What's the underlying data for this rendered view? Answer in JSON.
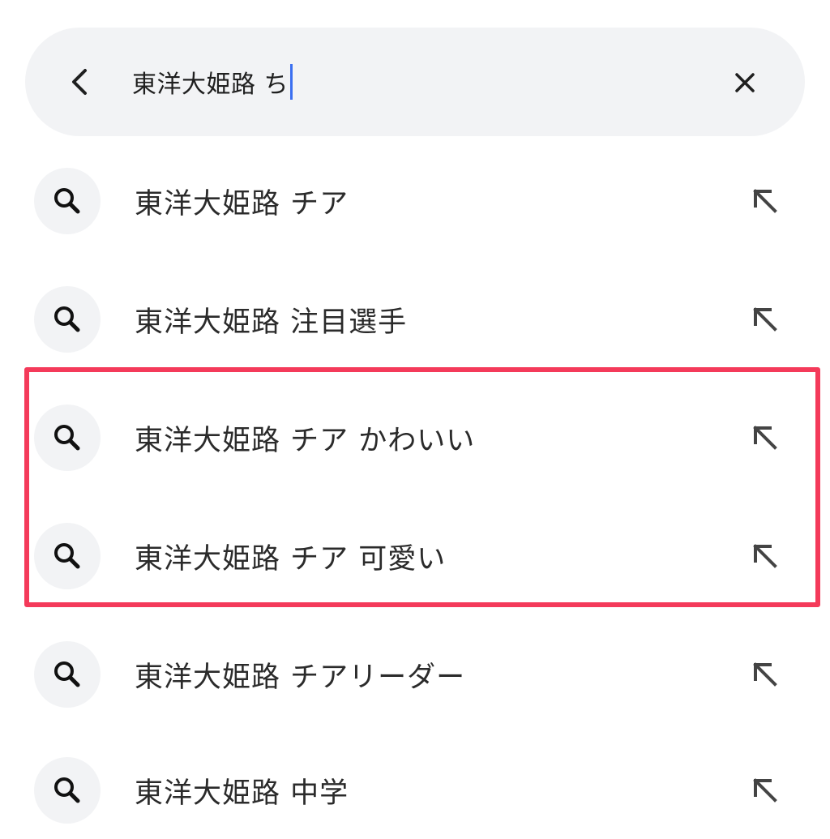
{
  "search": {
    "query": "東洋大姫路 ち",
    "back_icon": "chevron-left-icon",
    "clear_icon": "close-icon"
  },
  "suggestions": [
    {
      "label": "東洋大姫路 チア",
      "icon": "search-icon",
      "fill_icon": "arrow-up-left-icon"
    },
    {
      "label": "東洋大姫路 注目選手",
      "icon": "search-icon",
      "fill_icon": "arrow-up-left-icon"
    },
    {
      "label": "東洋大姫路 チア かわいい",
      "icon": "search-icon",
      "fill_icon": "arrow-up-left-icon"
    },
    {
      "label": "東洋大姫路 チア 可愛い",
      "icon": "search-icon",
      "fill_icon": "arrow-up-left-icon"
    },
    {
      "label": "東洋大姫路 チアリーダー",
      "icon": "search-icon",
      "fill_icon": "arrow-up-left-icon"
    },
    {
      "label": "東洋大姫路 中学",
      "icon": "search-icon",
      "fill_icon": "arrow-up-left-icon"
    }
  ],
  "colors": {
    "highlight_border": "#f43a5a",
    "caret": "#3b6ff0",
    "field_background": "#f2f3f5"
  }
}
